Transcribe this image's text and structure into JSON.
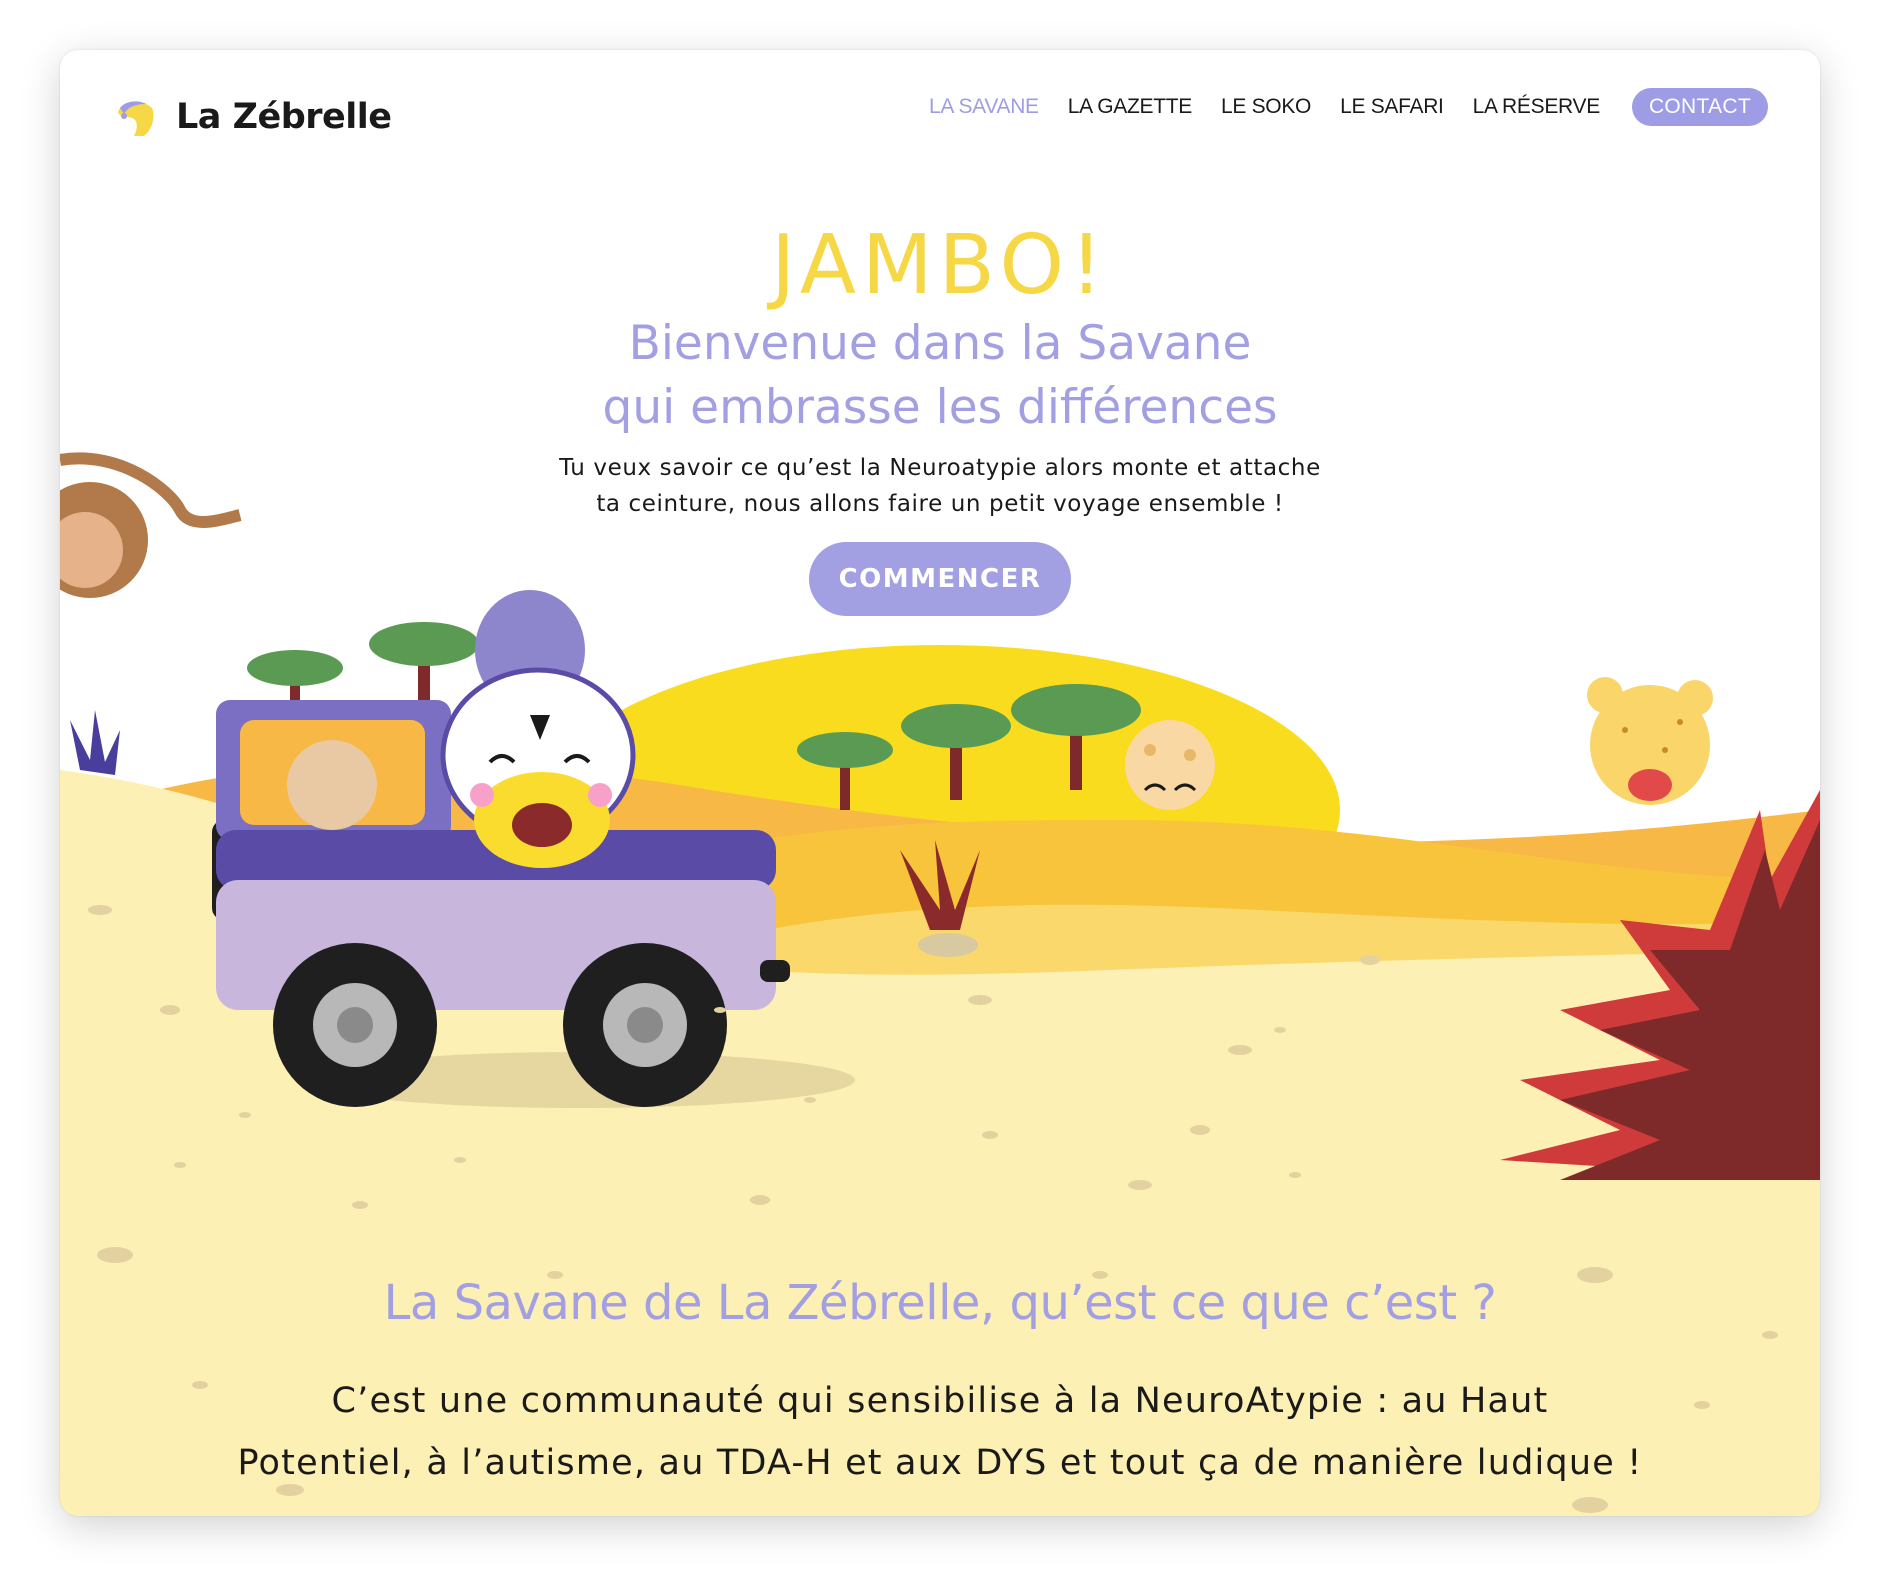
{
  "header": {
    "logo_text": "La Zébrelle",
    "nav": [
      {
        "label": "LA SAVANE",
        "active": true
      },
      {
        "label": "LA GAZETTE",
        "active": false
      },
      {
        "label": "LE SOKO",
        "active": false
      },
      {
        "label": "LE SAFARI",
        "active": false
      },
      {
        "label": "LA RÉSERVE",
        "active": false
      }
    ],
    "contact_label": "CONTACT"
  },
  "hero": {
    "title": "JAMBO!",
    "subtitle_line1": "Bienvenue dans la Savane",
    "subtitle_line2": "qui embrasse les différences",
    "intro_line1": "Tu veux savoir ce qu’est la Neuroatypie alors monte et attache",
    "intro_line2": "ta ceinture, nous allons faire un petit voyage ensemble !",
    "cta_label": "COMMENCER"
  },
  "section": {
    "title": "La Savane de La Zébrelle, qu’est ce que c’est ?",
    "text_line1": "C’est une communauté qui sensibilise à la NeuroAtypie : au Haut",
    "text_line2": "Potentiel, à l’autisme, au TDA-H et aux DYS et tout ça de manière ludique !"
  },
  "colors": {
    "accent_purple": "#a29fe3",
    "title_yellow": "#f6d847",
    "sand": "#fdf0b4",
    "sun": "#f9dc1e",
    "dune": "#f8c43c",
    "bush": "#7e2a2a"
  },
  "icons": [
    "zebra-logo-icon"
  ]
}
